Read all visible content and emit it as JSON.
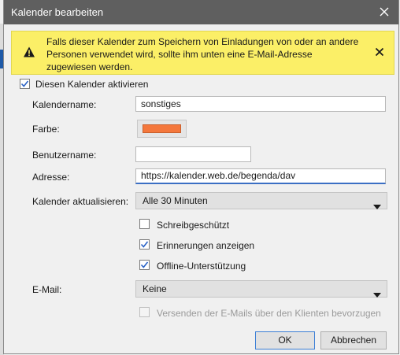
{
  "window": {
    "title": "Kalender bearbeiten"
  },
  "banner": {
    "text": "Falls dieser Kalender zum Speichern von Einladungen von oder an andere Personen verwendet wird, sollte ihm unten eine E-Mail-Adresse zugewiesen werden."
  },
  "enable": {
    "label": "Diesen Kalender aktivieren",
    "checked": true
  },
  "form": {
    "name_label": "Kalendername:",
    "name_value": "sonstiges",
    "color_label": "Farbe:",
    "color_value": "#f4773c",
    "username_label": "Benutzername:",
    "username_value": "",
    "address_label": "Adresse:",
    "address_value": "https://kalender.web.de/begenda/dav",
    "refresh_label": "Kalender aktualisieren:",
    "refresh_value": "Alle 30 Minuten",
    "readonly_label": "Schreibgeschützt",
    "readonly_checked": false,
    "reminders_label": "Erinnerungen anzeigen",
    "reminders_checked": true,
    "offline_label": "Offline-Unterstützung",
    "offline_checked": true,
    "email_label": "E-Mail:",
    "email_value": "Keine",
    "send_via_client_label": "Versenden der E-Mails über den Klienten bevorzugen",
    "send_via_client_checked": false
  },
  "buttons": {
    "ok": "OK",
    "cancel": "Abbrechen"
  },
  "colors": {
    "titlebar": "#5f5f5f",
    "banner": "#fbef67",
    "accent": "#3b6fc4"
  }
}
